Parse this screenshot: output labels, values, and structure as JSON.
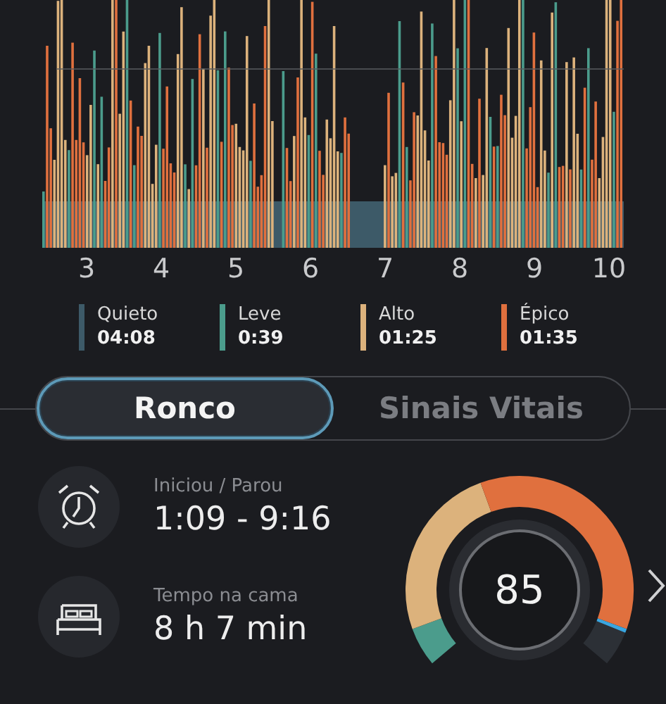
{
  "chart": {
    "x_labels": [
      "3",
      "4",
      "5",
      "6",
      "7",
      "8",
      "9",
      "10"
    ]
  },
  "legend": [
    {
      "label": "Quieto",
      "value": "04:08",
      "color": "#3d5a68"
    },
    {
      "label": "Leve",
      "value": "0:39",
      "color": "#4b9c8c"
    },
    {
      "label": "Alto",
      "value": "01:25",
      "color": "#dcb27c"
    },
    {
      "label": "Épico",
      "value": "01:35",
      "color": "#e0703e"
    }
  ],
  "tabs": [
    {
      "label": "Ronco",
      "selected": true
    },
    {
      "label": "Sinais Vitais",
      "selected": false
    }
  ],
  "stats": [
    {
      "kind": "alarm",
      "label": "Iniciou / Parou",
      "value": "1:09 - 9:16"
    },
    {
      "kind": "bed",
      "label": "Tempo na cama",
      "value": "8 h 7 min"
    }
  ],
  "score": {
    "value": "85"
  }
}
